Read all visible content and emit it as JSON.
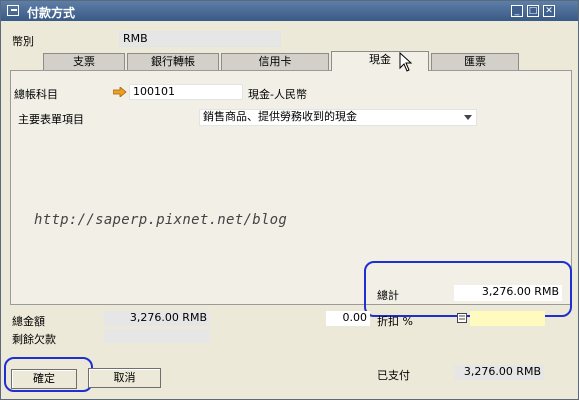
{
  "window": {
    "title": "付款方式"
  },
  "currency": {
    "label": "幣別",
    "value": "RMB"
  },
  "tabs": [
    {
      "label": "支票"
    },
    {
      "label": "銀行轉帳"
    },
    {
      "label": "信用卡"
    },
    {
      "label": "現金"
    },
    {
      "label": "匯票"
    }
  ],
  "cash": {
    "gl_account_label": "總帳科目",
    "gl_account_value": "100101",
    "gl_account_name": "現金-人民幣",
    "primary_form_item_label": "主要表單項目",
    "primary_form_item_value": "銷售商品、提供勞務收到的現金"
  },
  "watermark": "http://saperp.pixnet.net/blog",
  "totals": {
    "total_label": "總計",
    "total_value": "3,276.00 RMB",
    "overall_amount_label": "總金額",
    "overall_amount_value": "3,276.00 RMB",
    "balance_due_label": "剩餘欠款",
    "balance_due_value": "",
    "discount_value": "0.00",
    "discount_label": "折扣 %",
    "paid_label": "已支付",
    "paid_value": "3,276.00 RMB"
  },
  "buttons": {
    "ok": "確定",
    "cancel": "取消"
  },
  "colors": {
    "highlight": "#1f2fd0",
    "title_bar": "#3a5a86",
    "discount_field": "#fffbbf"
  }
}
